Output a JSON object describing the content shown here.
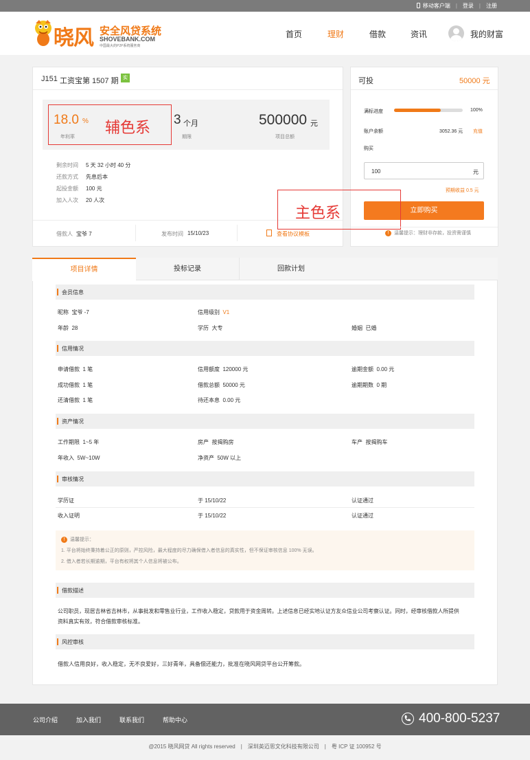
{
  "topbar": {
    "mobile": "移动客户端",
    "login": "登录",
    "register": "注册",
    "sep": "|"
  },
  "header": {
    "brand": "晓风",
    "slogan": "安全风贷系统",
    "domain": "SHOVEBANK.COM",
    "subslogan": "中国最大的P2P系统服务商",
    "nav": [
      "首页",
      "理财",
      "借款",
      "资讯"
    ],
    "active_nav": "理财",
    "my_wealth": "我的财富"
  },
  "project": {
    "code": "J151",
    "name": "工资宝第 1507 期",
    "badge": "实",
    "rate": "18.0",
    "rate_unit": "%",
    "rate_label": "年利率",
    "period": "3",
    "period_unit": "个月",
    "period_label": "期限",
    "total": "500000",
    "total_unit": "元",
    "total_label": "项目总额",
    "details": [
      {
        "label": "剩余时间",
        "value": "5 天 32 小时 40 分"
      },
      {
        "label": "还款方式",
        "value": "先息后本"
      },
      {
        "label": "起投金额",
        "value": "100 元"
      },
      {
        "label": "加入人次",
        "value": "20 人次"
      }
    ],
    "borrower_label": "借款人",
    "borrower": "宝爷 7",
    "publish_label": "发布时间",
    "publish": "15/10/23",
    "agreement": "查看协议模板"
  },
  "annotations": {
    "secondary": "辅色系",
    "primary": "主色系"
  },
  "invest": {
    "title": "可投",
    "amount": "50000 元",
    "progress_label": "满标进度",
    "progress_pct": 100,
    "progress_fill_fraction": 0.68,
    "progress_text": "100%",
    "balance_label": "账户余额",
    "balance": "3052.36 元",
    "recharge": "充值",
    "buy_label": "购买",
    "input_value": "100",
    "input_unit": "元",
    "expected": "预期收益 0.5 元",
    "buy_button": "立即购买",
    "tip_icon": "!",
    "tip": "温馨提示：理财非存款，投资需谨慎"
  },
  "tabs": [
    "项目详情",
    "投标记录",
    "回款计划"
  ],
  "member": {
    "title": "会员信息",
    "nickname_label": "昵称",
    "nickname": "宝爷 -7",
    "credit_label": "信用级别",
    "credit": "V1",
    "age_label": "年龄",
    "age": "28",
    "edu_label": "学历",
    "edu": "大专",
    "marriage_label": "婚姻",
    "marriage": "已婚"
  },
  "credit": {
    "title": "信用情况",
    "rows": [
      [
        "申请借款",
        "1 笔",
        "信用额度",
        "120000 元",
        "逾期金额",
        "0.00 元"
      ],
      [
        "成功借款",
        "1 笔",
        "借款总额",
        "50000 元",
        "逾期期数",
        "0 期"
      ],
      [
        "还清借款",
        "1 笔",
        "待还本息",
        "0.00 元",
        "",
        ""
      ]
    ]
  },
  "assets": {
    "title": "资产情况",
    "rows": [
      [
        "工作期限",
        "1~5 年",
        "房产",
        "按揭购房",
        "车产",
        "按揭购车"
      ],
      [
        "年收入",
        "5W~10W",
        "净资产",
        "50W 以上",
        "",
        ""
      ]
    ]
  },
  "audit": {
    "title": "审核情况",
    "rows": [
      {
        "name": "学历证",
        "date": "于 15/10/22",
        "status": "认证通过"
      },
      {
        "name": "收入证明",
        "date": "于 15/10/22",
        "status": "认证通过"
      }
    ]
  },
  "notice": {
    "icon": "!",
    "title": "温馨提示：",
    "lines": [
      "1. 平台将始终秉持着公正的原则，严控风险，最大程度的尽力确保借入者信息的真实性，但不保证审核信息 100% 无误。",
      "2. 借入者若长期逾期，平台有权将其个人信息将被公布。"
    ]
  },
  "desc": {
    "title": "借款描述",
    "lines": [
      "公司职员，现居吉林省吉林市，从事批发和零售业行业，工作收入稳定，贷款用于资金周转。上述信息已经实地认证方友众信业公司考察认证。同时，经审核借款人所提供",
      "资料真实有效，符合借款审核标准。"
    ]
  },
  "risk": {
    "title": "风控审核",
    "text": "借款人信用良好，收入稳定，无不良爱好，三好青年，具备偿还能力，批准在晓风网贷平台公开筹款。"
  },
  "footer": {
    "links": [
      "公司介绍",
      "加入我们",
      "联系我们",
      "帮助中心"
    ],
    "phone": "400-800-5237",
    "copyright": "@2015 晓风网贷 All rights reserved　|　深圳英迈思文化科技有限公司　|　粤 ICP 证 100952 号"
  },
  "colors": {
    "primary": "#f07a18",
    "annotation": "#e53935"
  }
}
